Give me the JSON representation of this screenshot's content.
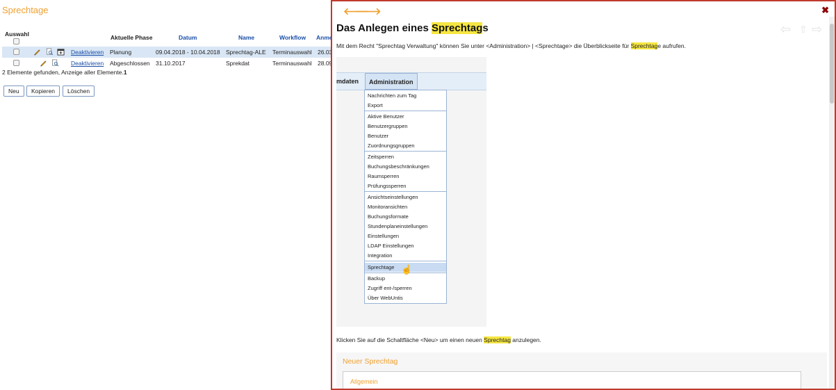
{
  "page": {
    "title": "Sprechtage"
  },
  "table": {
    "headers": {
      "select": "Auswahl",
      "phase": "Aktuelle Phase",
      "date": "Datum",
      "name": "Name",
      "workflow": "Workflow",
      "reg": "Anme"
    },
    "rows": [
      {
        "action": "Deaktivieren",
        "phase": "Planung",
        "date": "09.04.2018 - 10.04.2018",
        "name": "Sprechtag-ALE",
        "workflow": "Terminauswahl",
        "reg": "26.03"
      },
      {
        "action": "Deaktivieren",
        "phase": "Abgeschlossen",
        "date": "31.10.2017",
        "name": "Sprekdat",
        "workflow": "Terminauswahl",
        "reg": "28.09"
      }
    ],
    "found_text": "2 Elemente gefunden, Anzeige aller Elemente.",
    "found_page": "1"
  },
  "buttons": {
    "new": "Neu",
    "copy": "Kopieren",
    "delete": "Löschen"
  },
  "help": {
    "back_arrow": "🡐",
    "forward_arrow": "🡒",
    "close": "✖",
    "title_prefix": "Das Anlegen eines ",
    "title_highlight": "Sprechtag",
    "title_suffix": "s",
    "p1_prefix": "Mit dem Recht \"Sprechtag Verwaltung\" können Sie unter <Administration> | <Sprechtage> die Überblickseite für ",
    "p1_highlight": "Sprechtag",
    "p1_suffix": "e aufrufen.",
    "p2_prefix": "Klicken Sie auf die Schaltfläche <Neu> um einen neuen ",
    "p2_highlight": "Sprechtag",
    "p2_suffix": " anzulegen.",
    "shot": {
      "tab_left": "mdaten",
      "tab_active": "Administration",
      "menu_items": [
        "Nachrichten zum Tag",
        "Export",
        "Aktive Benutzer",
        "Benutzergruppen",
        "Benutzer",
        "Zuordnungsgruppen",
        "Zeitsperren",
        "Buchungsbeschränkungen",
        "Raumsperren",
        "Prüfungssperren",
        "Ansichtseinstellungen",
        "Monitoransichten",
        "Buchungsformate",
        "Stundenplaneinstellungen",
        "Einstellungen",
        "LDAP Einstellungen",
        "Integration",
        "Sprechtage",
        "Backup",
        "Zugriff ent-/sperren",
        "Über WebUntis"
      ]
    },
    "new_section": {
      "title": "Neuer Sprechtag",
      "general": "Allgemein"
    }
  }
}
